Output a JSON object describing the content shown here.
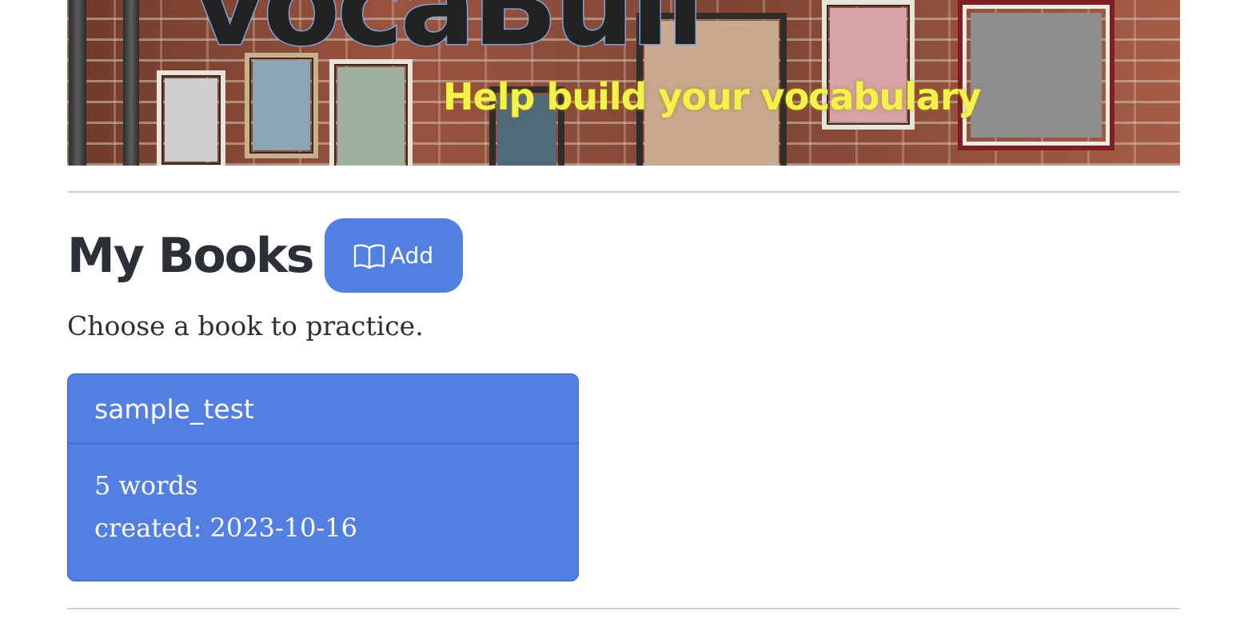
{
  "banner": {
    "title": "vocaBuil",
    "tagline": "Help build your vocabulary"
  },
  "section": {
    "title": "My Books",
    "add_button_label": "Add",
    "add_button_icon": "open-book-icon",
    "subtitle": "Choose a book to practice."
  },
  "books": [
    {
      "name": "sample_test",
      "word_count": "5 words",
      "created": "created: 2023-10-16"
    }
  ],
  "colors": {
    "accent": "#5280e1",
    "tagline": "#f2f24a",
    "text": "#2b3038"
  }
}
